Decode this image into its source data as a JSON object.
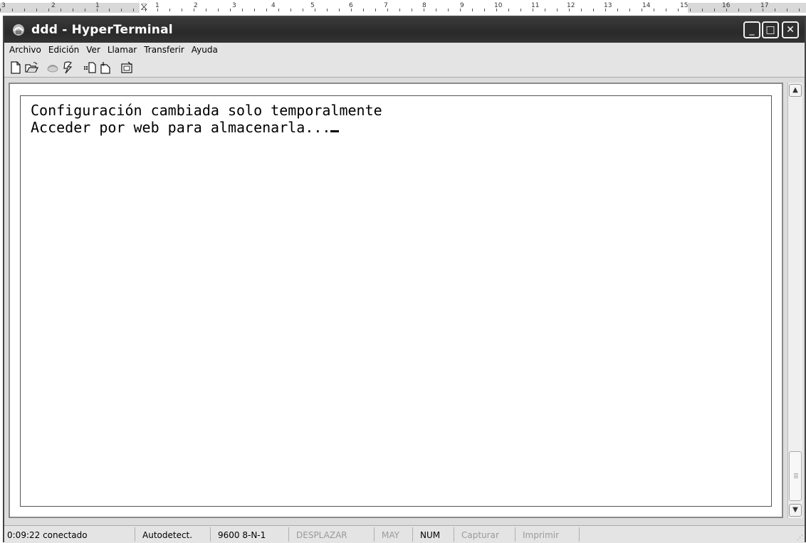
{
  "ruler": {
    "numbers": [
      "3",
      "2",
      "1",
      "1",
      "2",
      "3",
      "4",
      "5",
      "6",
      "7",
      "8",
      "9",
      "10",
      "11",
      "12",
      "13",
      "14",
      "15",
      "16",
      "17"
    ]
  },
  "window": {
    "title": "ddd - HyperTerminal",
    "controls": {
      "minimize": "_",
      "maximize": "□",
      "close": "✕"
    }
  },
  "menu": [
    "Archivo",
    "Edición",
    "Ver",
    "Llamar",
    "Transferir",
    "Ayuda"
  ],
  "toolbar": {
    "buttons": [
      "new-icon",
      "open-icon",
      "call-icon",
      "disconnect-icon",
      "send-icon",
      "receive-icon",
      "properties-icon"
    ]
  },
  "terminal": {
    "lines": [
      "Configuración cambiada solo temporalmente",
      "Acceder por web para almacenarla..."
    ]
  },
  "status": {
    "connected": "0:09:22 conectado",
    "detect": "Autodetect.",
    "port": "9600 8-N-1",
    "scroll": "DESPLAZAR",
    "caps": "MAY",
    "num": "NUM",
    "capture": "Capturar",
    "print": "Imprimir"
  }
}
